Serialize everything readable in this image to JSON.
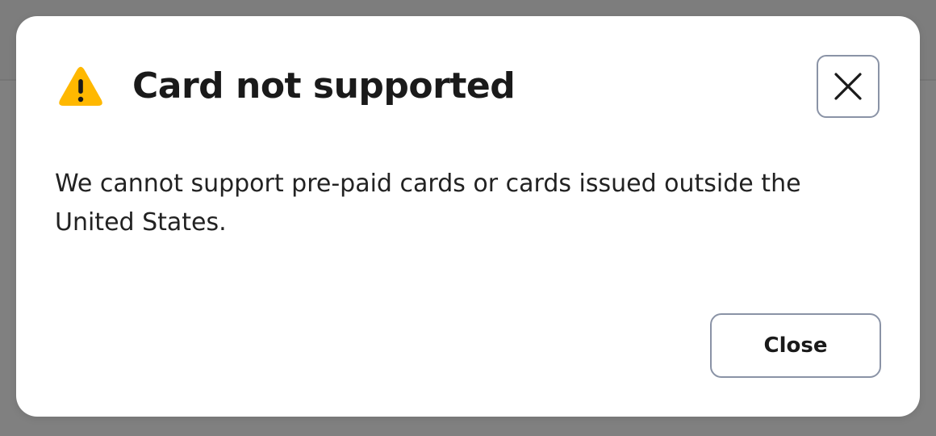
{
  "dialog": {
    "title": "Card not supported",
    "icon": "warning-icon",
    "close_icon": "close-icon",
    "message": "We cannot support pre-paid cards or cards issued outside the United States.",
    "close_button_label": "Close"
  },
  "colors": {
    "overlay": "#808080",
    "dialog_background": "#ffffff",
    "warning": "#FFB800",
    "title_text": "#1a1a1a",
    "body_text": "#222222",
    "button_border": "#8a93a6"
  }
}
